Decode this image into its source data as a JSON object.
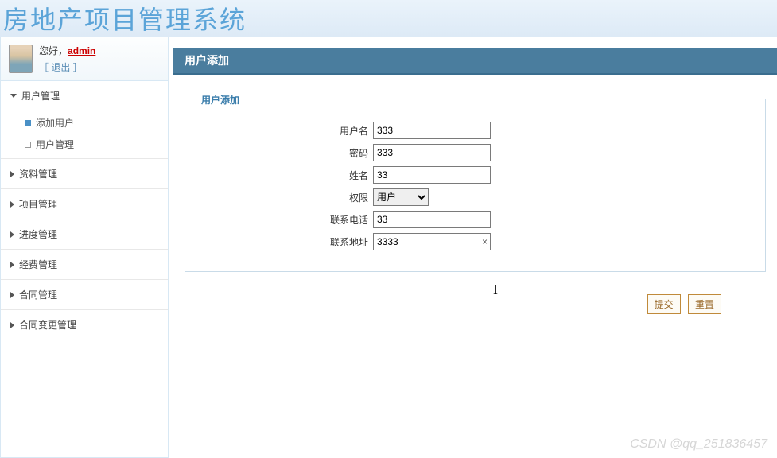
{
  "header": {
    "title": "房地产项目管理系统"
  },
  "user": {
    "greeting": "您好，",
    "name": "admin",
    "logout": "［ 退出 ］"
  },
  "menu": {
    "items": [
      {
        "label": "用户管理",
        "expanded": true,
        "submenu": [
          {
            "label": "添加用户",
            "active": true
          },
          {
            "label": "用户管理",
            "active": false
          }
        ]
      },
      {
        "label": "资料管理",
        "expanded": false
      },
      {
        "label": "项目管理",
        "expanded": false
      },
      {
        "label": "进度管理",
        "expanded": false
      },
      {
        "label": "经费管理",
        "expanded": false
      },
      {
        "label": "合同管理",
        "expanded": false
      },
      {
        "label": "合同变更管理",
        "expanded": false
      }
    ]
  },
  "panel": {
    "title": "用户添加",
    "legend": "用户添加",
    "fields": {
      "username": {
        "label": "用户名",
        "value": "333"
      },
      "password": {
        "label": "密码",
        "value": "333"
      },
      "name": {
        "label": "姓名",
        "value": "33"
      },
      "role": {
        "label": "权限",
        "value": "用户"
      },
      "phone": {
        "label": "联系电话",
        "value": "33"
      },
      "address": {
        "label": "联系地址",
        "value": "3333"
      }
    },
    "buttons": {
      "submit": "提交",
      "reset": "重置"
    }
  },
  "watermark": "CSDN @qq_251836457"
}
